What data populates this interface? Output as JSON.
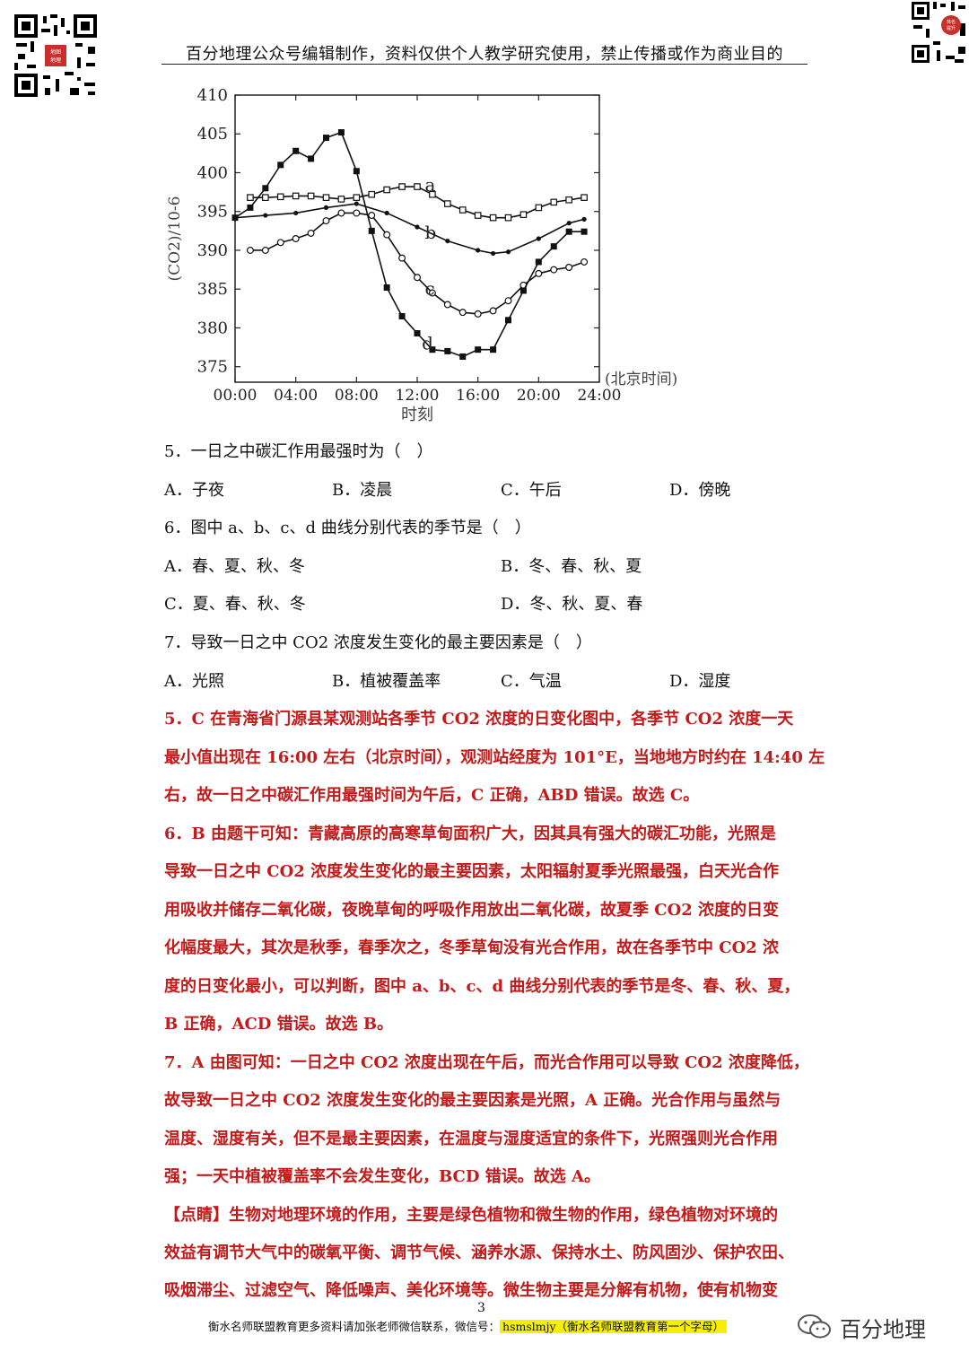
{
  "header": {
    "text": "百分地理公众号编辑制作，资料仅供个人教学研究使用，禁止传播或作为商业目的"
  },
  "qr_left": {
    "logo_text": "地图 地理"
  },
  "qr_right": {
    "logo_text": "林名 提升"
  },
  "chart_data": {
    "type": "line",
    "ylabel": "(CO2)/10-6",
    "xlabel": "时刻",
    "x_unit": "(北京时间)",
    "yticks": [
      "410",
      "405",
      "400",
      "395",
      "390",
      "385",
      "380",
      "375"
    ],
    "xticks": [
      "00:00",
      "04:00",
      "08:00",
      "12:00",
      "16:00",
      "20:00",
      "24:00"
    ],
    "ylim": [
      373,
      410
    ],
    "xlim": [
      0,
      24
    ],
    "series": [
      {
        "name": "a",
        "marker": "open-square",
        "x": [
          1,
          2,
          3,
          4,
          5,
          6,
          7,
          8,
          9,
          10,
          11,
          12,
          13,
          14,
          15,
          16,
          17,
          18,
          19,
          20,
          21,
          22,
          23
        ],
        "y": [
          396.8,
          396.8,
          396.9,
          397.0,
          397.0,
          396.8,
          396.6,
          396.8,
          397.2,
          397.8,
          398.2,
          398.2,
          397.2,
          396.0,
          395.2,
          394.5,
          394.2,
          394.2,
          394.6,
          395.5,
          396.2,
          396.5,
          396.8
        ]
      },
      {
        "name": "b",
        "marker": "filled-dot",
        "x": [
          0,
          2,
          4,
          6,
          8,
          10,
          12,
          14,
          16,
          17,
          18,
          20,
          22,
          23
        ],
        "y": [
          394.2,
          394.5,
          394.8,
          395.5,
          396.0,
          394.8,
          393.0,
          391.2,
          390.0,
          389.6,
          389.8,
          391.5,
          393.5,
          394.0
        ]
      },
      {
        "name": "c",
        "marker": "open-circle",
        "x": [
          1,
          2,
          3,
          4,
          5,
          6,
          7,
          8,
          9,
          10,
          11,
          12,
          13,
          14,
          15,
          16,
          17,
          18,
          19,
          20,
          21,
          22,
          23
        ],
        "y": [
          390.0,
          390.0,
          391.0,
          391.5,
          392.2,
          393.8,
          394.8,
          394.8,
          394.5,
          392.0,
          389.0,
          386.5,
          384.5,
          383.0,
          382.0,
          381.8,
          382.2,
          383.5,
          385.5,
          387.0,
          387.5,
          387.8,
          388.5
        ]
      },
      {
        "name": "d",
        "marker": "filled-square",
        "x": [
          0,
          1,
          2,
          3,
          4,
          5,
          6,
          7,
          8,
          9,
          10,
          11,
          12,
          13,
          14,
          15,
          16,
          17,
          18,
          19,
          20,
          21,
          22,
          23
        ],
        "y": [
          394.2,
          395.5,
          398.0,
          401.0,
          402.8,
          401.8,
          404.5,
          405.2,
          400.2,
          392.5,
          385.2,
          381.5,
          379.3,
          377.2,
          377.0,
          376.3,
          377.2,
          377.2,
          381.0,
          384.8,
          388.5,
          390.5,
          392.4,
          392.4
        ]
      }
    ]
  },
  "q5": {
    "stem": "5．一日之中碳汇作用最强时为（　）",
    "a": "A．子夜",
    "b": "B．凌晨",
    "c": "C．午后",
    "d": "D．傍晚"
  },
  "q6": {
    "stem": "6．图中 a、b、c、d 曲线分别代表的季节是（　）",
    "a": "A．春、夏、秋、冬",
    "b": "B．冬、春、秋、夏",
    "c": "C．夏、春、秋、冬",
    "d": "D．冬、秋、夏、春"
  },
  "q7": {
    "stem": "7．导致一日之中 CO2 浓度发生变化的最主要因素是（　）",
    "a": "A．光照",
    "b": "B．植被覆盖率",
    "c": "C．气温",
    "d": "D．湿度"
  },
  "answers": {
    "a5": [
      "5．C 在青海省门源县某观测站各季节 CO2 浓度的日变化图中，各季节 CO2 浓度一天",
      "最小值出现在 16:00 左右（北京时间），观测站经度为 101°E，当地地方时约在 14:40 左",
      "右，故一日之中碳汇作用最强时间为午后，C 正确，ABD 错误。故选 C。"
    ],
    "a6": [
      "6．B 由题干可知：青藏高原的高寒草甸面积广大，因其具有强大的碳汇功能，光照是",
      "导致一日之中 CO2 浓度发生变化的最主要因素，太阳辐射夏季光照最强，白天光合作",
      "用吸收并储存二氧化碳，夜晚草甸的呼吸作用放出二氧化碳，故夏季 CO2 浓度的日变",
      "化幅度最大，其次是秋季，春季次之，冬季草甸没有光合作用，故在各季节中 CO2 浓",
      "度的日变化最小，可以判断，图中 a、b、c、d 曲线分别代表的季节是冬、春、秋、夏，",
      "B 正确，ACD 错误。故选 B。"
    ],
    "a7": [
      "7．A 由图可知：一日之中 CO2 浓度出现在午后，而光合作用可以导致 CO2 浓度降低，",
      "故导致一日之中 CO2 浓度发生变化的最主要因素是光照，A 正确。光合作用与虽然与",
      "温度、湿度有关，但不是最主要因素，在温度与湿度适宜的条件下，光照强则光合作用",
      "强；一天中植被覆盖率不会发生变化，BCD 错误。故选 A。"
    ],
    "tip_label": "【点睛】",
    "tip": [
      "生物对地理环境的作用，主要是绿色植物和微生物的作用，绿色植物对环境的",
      "效益有调节大气中的碳氧平衡、调节气候、涵养水源、保持水土、防风固沙、保护农田、",
      "吸烟滞尘、过滤空气、降低噪声、美化环境等。微生物主要是分解有机物，使有机物变"
    ]
  },
  "footer": {
    "page": "3",
    "text": "衡水名师联盟教育更多资料请加张老师微信联系，微信号：",
    "wechat": "hsmslmjy（衡水名师联盟教育第一个字母）"
  },
  "brand": {
    "name": "百分地理"
  }
}
